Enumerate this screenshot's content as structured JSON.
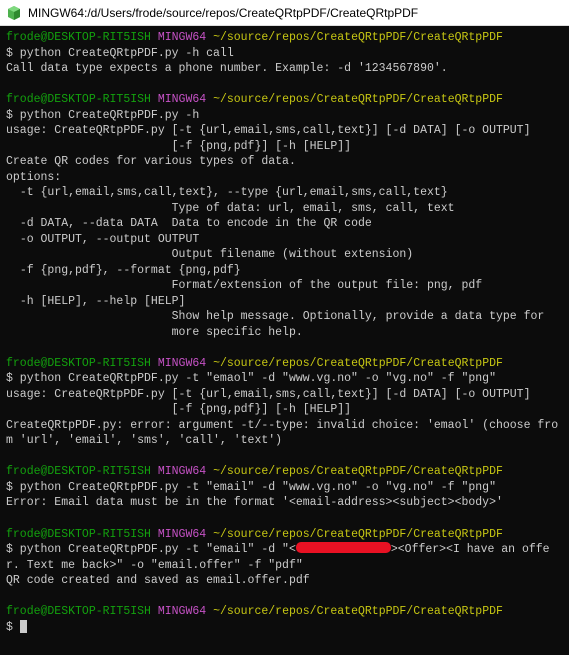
{
  "window": {
    "title": "MINGW64:/d/Users/frode/source/repos/CreateQRtpPDF/CreateQRtpPDF"
  },
  "prompt": {
    "user_host": "frode@DESKTOP-RIT5ISH",
    "env": "MINGW64",
    "path": "~/source/repos/CreateQRtpPDF/CreateQRtpPDF",
    "sigil": "$"
  },
  "blocks": [
    {
      "cmd": "python CreateQRtpPDF.py -h call",
      "out": [
        "Call data type expects a phone number. Example: -d '1234567890'."
      ]
    },
    {
      "cmd": "python CreateQRtpPDF.py -h",
      "out": [
        "usage: CreateQRtpPDF.py [-t {url,email,sms,call,text}] [-d DATA] [-o OUTPUT]",
        "                        [-f {png,pdf}] [-h [HELP]]",
        "",
        "Create QR codes for various types of data.",
        "",
        "options:",
        "  -t {url,email,sms,call,text}, --type {url,email,sms,call,text}",
        "                        Type of data: url, email, sms, call, text",
        "  -d DATA, --data DATA  Data to encode in the QR code",
        "  -o OUTPUT, --output OUTPUT",
        "                        Output filename (without extension)",
        "  -f {png,pdf}, --format {png,pdf}",
        "                        Format/extension of the output file: png, pdf",
        "  -h [HELP], --help [HELP]",
        "                        Show help message. Optionally, provide a data type for",
        "                        more specific help."
      ]
    },
    {
      "cmd": "python CreateQRtpPDF.py -t \"emaol\" -d \"www.vg.no\" -o \"vg.no\" -f \"png\"",
      "out": [
        "usage: CreateQRtpPDF.py [-t {url,email,sms,call,text}] [-d DATA] [-o OUTPUT]",
        "                        [-f {png,pdf}] [-h [HELP]]",
        "CreateQRtpPDF.py: error: argument -t/--type: invalid choice: 'emaol' (choose from 'url', 'email', 'sms', 'call', 'text')"
      ]
    },
    {
      "cmd": "python CreateQRtpPDF.py -t \"email\" -d \"www.vg.no\" -o \"vg.no\" -f \"png\"",
      "out": [
        "Error: Email data must be in the format '<email-address><subject><body>'"
      ]
    },
    {
      "cmd_pre": "python CreateQRtpPDF.py -t \"email\" -d \"<",
      "cmd_post": "><Offer><I have an offer. Text me back>\" -o \"email.offer\" -f \"pdf\"",
      "redacted": true,
      "out": [
        "QR code created and saved as email.offer.pdf"
      ]
    },
    {
      "cmd": "",
      "cursor": true,
      "out": []
    }
  ]
}
